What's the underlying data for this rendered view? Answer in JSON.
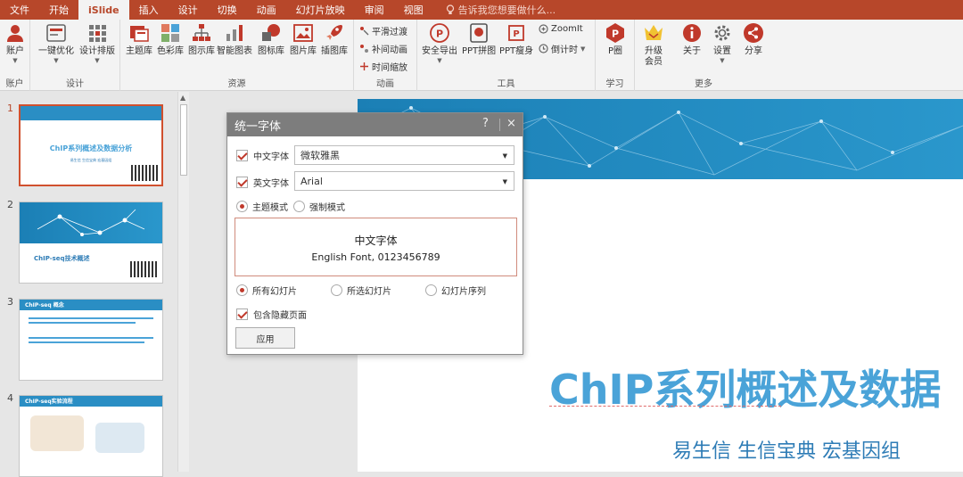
{
  "tabs": [
    "文件",
    "开始",
    "iSlide",
    "插入",
    "设计",
    "切换",
    "动画",
    "幻灯片放映",
    "审阅",
    "视图"
  ],
  "active_tab": "iSlide",
  "tell_me": "告诉我您想要做什么...",
  "ribbon": {
    "account": {
      "btn": "账户",
      "group": "账户"
    },
    "design": {
      "btn1": "一键优化",
      "btn2": "设计排版",
      "group": "设计"
    },
    "resources": {
      "btns": [
        "主题库",
        "色彩库",
        "图示库",
        "智能图表",
        "图标库",
        "图片库",
        "插图库"
      ],
      "group": "资源"
    },
    "animation": {
      "items": [
        "平滑过渡",
        "补间动画",
        "时间缩放"
      ],
      "group": "动画"
    },
    "tools": {
      "btns": [
        "安全导出",
        "PPT拼图",
        "PPT瘦身"
      ],
      "zoomit": "ZoomIt",
      "timer": "倒计时",
      "group": "工具"
    },
    "learn": {
      "btn": "P圈",
      "group": "学习"
    },
    "more": {
      "btns": [
        "升级\n会员",
        "关于",
        "设置",
        "分享"
      ],
      "btn_upgrade_1": "升级",
      "btn_upgrade_2": "会员",
      "group": "更多"
    }
  },
  "slides": {
    "numbers": [
      "1",
      "2",
      "3",
      "4"
    ],
    "s1_title": "ChIP系列概述及数据分析",
    "s1_sub": "易生信 生信宝典 宏基因组",
    "s2_title": "ChIP-seq技术概述",
    "s3_title": "ChIP-seq 概念",
    "s4_title": "ChIP-seq实验流程"
  },
  "main_slide": {
    "title": "ChIP系列概述及数据",
    "subtitle": "易生信 生信宝典 宏基因组"
  },
  "dialog": {
    "title": "统一字体",
    "help": "?",
    "close": "×",
    "cn_label": "中文字体",
    "cn_value": "微软雅黑",
    "en_label": "英文字体",
    "en_value": "Arial",
    "mode_theme": "主题模式",
    "mode_force": "强制模式",
    "preview_cn": "中文字体",
    "preview_en": "English Font, 0123456789",
    "scope_all": "所有幻灯片",
    "scope_selected": "所选幻灯片",
    "scope_seq": "幻灯片序列",
    "include_hidden": "包含隐藏页面",
    "apply": "应用"
  },
  "colors": {
    "accent": "#b7472a",
    "check": "#c0392b",
    "slide_blue": "#4aa3d8"
  }
}
